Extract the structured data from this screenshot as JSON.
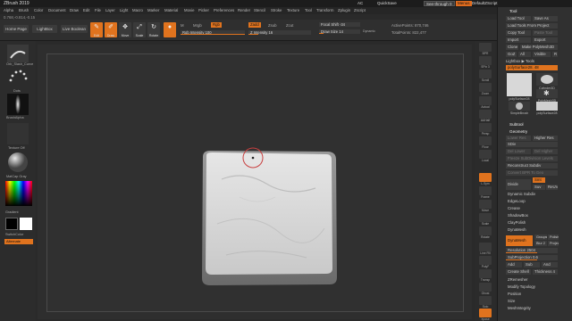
{
  "app": {
    "title": "ZBrush 2019",
    "menus": [
      "Alpha",
      "Brush",
      "Color",
      "Document",
      "Draw",
      "Edit",
      "File",
      "Layer",
      "Light",
      "Macro",
      "Marker",
      "Material",
      "Movie",
      "Picker",
      "Preferences",
      "Render",
      "Stencil",
      "Stroke",
      "Texture",
      "Tool",
      "Transform",
      "Zplugin",
      "Zscript"
    ],
    "coords": "0.768,-0.814,-0.15",
    "titlebar": {
      "ac": "AC",
      "quicksave": "QuickSave",
      "see_through": "See-through  0",
      "menus_btn": "Menus",
      "default_zscript": "DefaultZScript"
    }
  },
  "toolbar": {
    "home_page": "Home Page",
    "lightbox": "LightBox",
    "live_boolean": "Live Boolean",
    "modes": [
      {
        "label": "Edit",
        "glyph": "✎",
        "icon": "edit-icon",
        "active": true
      },
      {
        "label": "Draw",
        "glyph": "✐",
        "icon": "draw-icon",
        "active": true
      },
      {
        "label": "Move",
        "glyph": "✥",
        "icon": "move-icon",
        "active": false
      },
      {
        "label": "Scale",
        "glyph": "⤢",
        "icon": "scale-icon",
        "active": false
      },
      {
        "label": "Rotate",
        "glyph": "↻",
        "icon": "rotate-icon",
        "active": false
      }
    ],
    "mrgb": "Mrgb",
    "rgb": "Rgb",
    "m_label": "M",
    "rgb_intensity": "Rgb Intensity 100",
    "zadd": "Zadd",
    "zsub": "Zsub",
    "zcut": "Zcut",
    "z_intensity": "Z Intensity 16",
    "focal_shift": "Focal Shift -34",
    "draw_size": "Draw Size 14",
    "dynamic": "Dynamic",
    "active_points": "ActivePoints: 870,746",
    "total_points": "TotalPoints: 822,477"
  },
  "left_shelf": {
    "brush": "Orb_Slash_Curve",
    "stroke": "Dots",
    "alpha": "BrushAlpha",
    "texture": "Texture Off",
    "material": "MatCap Gray",
    "gradient": "Gradient",
    "switch_color": "SwitchColor",
    "alternate": "Alternate"
  },
  "right_shelf": {
    "buttons": [
      "BPR",
      "SPix 3",
      "Scroll",
      "Zoom",
      "Actual",
      "AAHalf",
      "Persp",
      "Floor",
      "Local",
      "L.Sym",
      "Frame",
      "Move",
      "Scale",
      "Rotate",
      "Line Fill",
      "PolyF",
      "Transp",
      "Ghost",
      "Solo",
      "Xpose"
    ]
  },
  "tool_panel": {
    "header": "Tool",
    "load_tool": "Load Tool",
    "save_as": "Save As",
    "load_from_project": "Load Tools From Project",
    "copy_tool": "Copy Tool",
    "paste_tool": "Paste Tool",
    "import": "Import",
    "export": "Export",
    "clone": "Clone",
    "make_polymesh": "Make PolyMesh3D",
    "goz": "GoZ",
    "all": "All",
    "visible": "Visible",
    "r": "R",
    "lightbox_tools": "Lightbox ▶ Tools",
    "current_tool": "polySurface28. 48",
    "thumbs": [
      "polySurface28",
      "Cylinder3D",
      "PolyMesh3D",
      "SimpleBrush",
      "polySurface28"
    ],
    "subtool": "Subtool",
    "geometry": "Geometry",
    "lower_res": "Lower Res",
    "higher_res": "Higher Res",
    "sdiv": "SDiv",
    "del_lower": "Del Lower",
    "del_higher": "Del Higher",
    "freeze_subdiv": "Freeze SubDivision Levels",
    "reconstruct_subdiv": "Reconstruct Subdiv",
    "convert_bpr": "Convert BPR To Geo",
    "divide": "Divide",
    "smt": "Smt",
    "suv": "Suv",
    "rsmt": "ReUV",
    "dynamic_subdiv": "Dynamic Subdiv",
    "edgeloop": "EdgeLoop",
    "crease": "Crease",
    "shadowbox": "ShadowBox",
    "claypolish": "ClayPolish",
    "dynamesh": "DynaMesh",
    "dynamesh_btn": "DynaMesh",
    "groups": "Groups",
    "polish": "Polish",
    "blur": "Blur 2",
    "project": "Project",
    "resolution": "Resolution 2504",
    "subprojection": "SubProjection 0.6",
    "add": "Add",
    "sub": "Sub",
    "and": "And",
    "create_shell": "Create Shell",
    "thickness": "Thickness 4",
    "zremesher": "ZRemesher",
    "modify_topology": "Modify Topology",
    "position": "Position",
    "size": "Size",
    "mesh_integrity": "MeshIntegrity"
  },
  "colors": {
    "accent": "#e0731e",
    "bg": "#2a2a2a",
    "panel": "#303030"
  }
}
